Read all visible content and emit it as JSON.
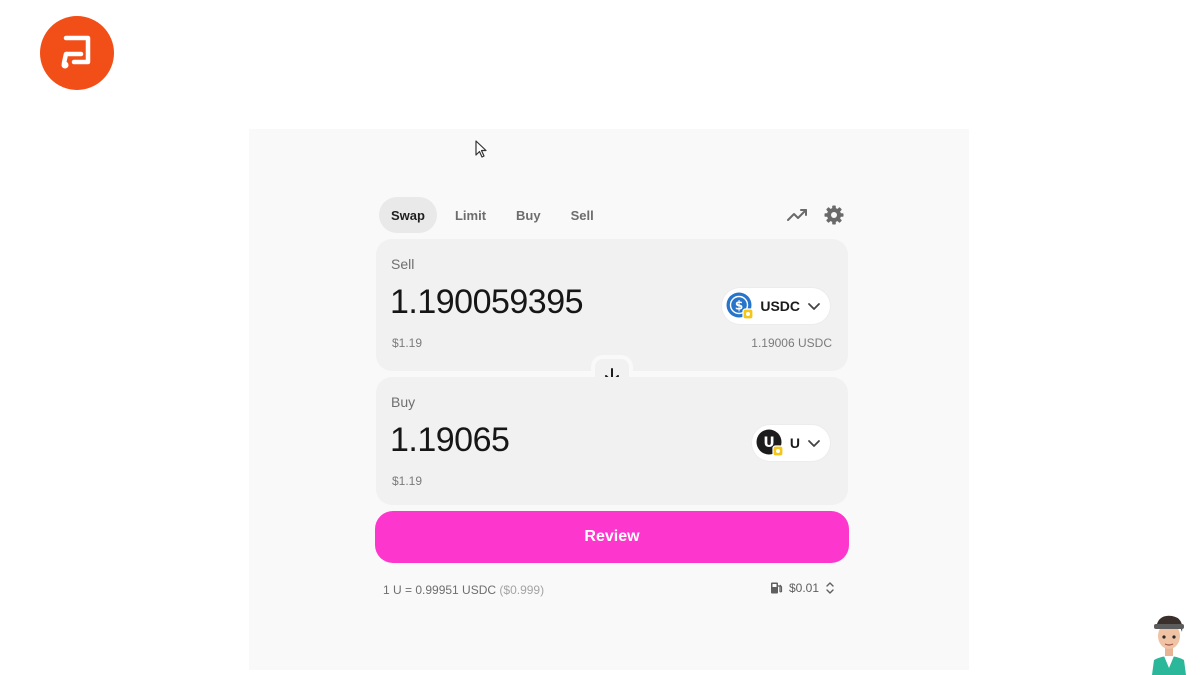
{
  "colors": {
    "brand_logo": "#f24e17",
    "review_button": "#fd36cd",
    "usdc_blue": "#2775ca",
    "token_badge": "#f5c518"
  },
  "tabs": [
    {
      "label": "Swap",
      "active": true
    },
    {
      "label": "Limit",
      "active": false
    },
    {
      "label": "Buy",
      "active": false
    },
    {
      "label": "Sell",
      "active": false
    }
  ],
  "tools": {
    "chart_icon": "trend-up-icon",
    "settings_icon": "gear-icon"
  },
  "sell": {
    "label": "Sell",
    "amount": "1.190059395",
    "usd_value": "$1.19",
    "token": "USDC",
    "balance": "1.19006 USDC"
  },
  "buy": {
    "label": "Buy",
    "amount": "1.19065",
    "usd_value": "$1.19",
    "token": "U"
  },
  "review_label": "Review",
  "rate": {
    "text": "1 U = 0.99951 USDC",
    "usd": "($0.999)"
  },
  "fee": {
    "value": "$0.01"
  }
}
